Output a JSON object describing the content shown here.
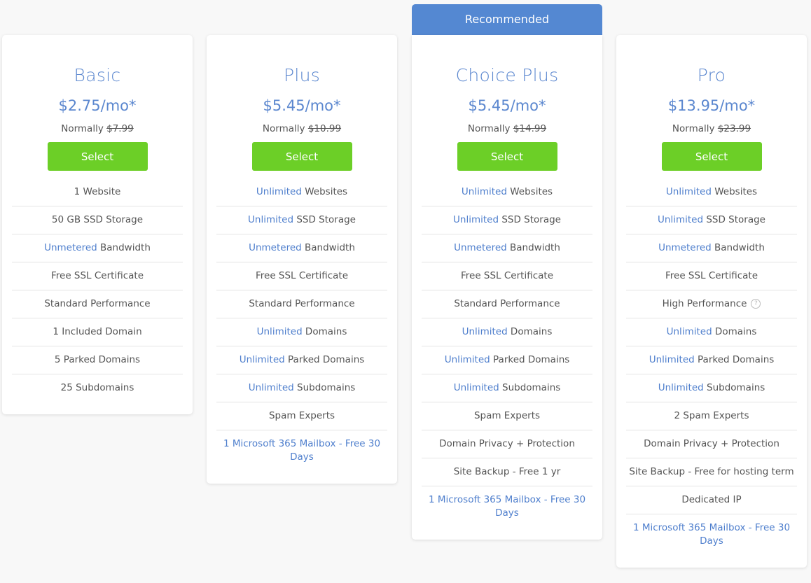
{
  "ribbon": {
    "label": "Recommended",
    "color": "#5488d2"
  },
  "colors": {
    "accent": "#5b87cf",
    "button": "#6ccf27"
  },
  "plans": [
    {
      "name": "Basic",
      "price": "$2.75/mo*",
      "normally_label": "Normally",
      "normal_price": "$7.99",
      "select_label": "Select",
      "features": [
        {
          "hl": "",
          "text": "1 Website"
        },
        {
          "hl": "",
          "text": "50 GB SSD Storage"
        },
        {
          "hl": "Unmetered",
          "text": " Bandwidth"
        },
        {
          "hl": "",
          "text": "Free SSL Certificate"
        },
        {
          "hl": "",
          "text": "Standard Performance"
        },
        {
          "hl": "",
          "text": "1 Included Domain"
        },
        {
          "hl": "",
          "text": "5 Parked Domains"
        },
        {
          "hl": "",
          "text": "25 Subdomains"
        }
      ]
    },
    {
      "name": "Plus",
      "price": "$5.45/mo*",
      "normally_label": "Normally",
      "normal_price": "$10.99",
      "select_label": "Select",
      "features": [
        {
          "hl": "Unlimited",
          "text": " Websites"
        },
        {
          "hl": "Unlimited",
          "text": " SSD Storage"
        },
        {
          "hl": "Unmetered",
          "text": " Bandwidth"
        },
        {
          "hl": "",
          "text": "Free SSL Certificate"
        },
        {
          "hl": "",
          "text": "Standard Performance"
        },
        {
          "hl": "Unlimited",
          "text": " Domains"
        },
        {
          "hl": "Unlimited",
          "text": " Parked Domains"
        },
        {
          "hl": "Unlimited",
          "text": " Subdomains"
        },
        {
          "hl": "",
          "text": "Spam Experts"
        },
        {
          "link": "1 Microsoft 365 Mailbox - Free 30 Days"
        }
      ]
    },
    {
      "name": "Choice Plus",
      "price": "$5.45/mo*",
      "normally_label": "Normally",
      "normal_price": "$14.99",
      "select_label": "Select",
      "recommended": true,
      "features": [
        {
          "hl": "Unlimited",
          "text": " Websites"
        },
        {
          "hl": "Unlimited",
          "text": " SSD Storage"
        },
        {
          "hl": "Unmetered",
          "text": " Bandwidth"
        },
        {
          "hl": "",
          "text": "Free SSL Certificate"
        },
        {
          "hl": "",
          "text": "Standard Performance"
        },
        {
          "hl": "Unlimited",
          "text": " Domains"
        },
        {
          "hl": "Unlimited",
          "text": " Parked Domains"
        },
        {
          "hl": "Unlimited",
          "text": " Subdomains"
        },
        {
          "hl": "",
          "text": "Spam Experts"
        },
        {
          "hl": "",
          "text": "Domain Privacy + Protection"
        },
        {
          "hl": "",
          "text": "Site Backup - Free 1 yr"
        },
        {
          "link": "1 Microsoft 365 Mailbox - Free 30 Days"
        }
      ]
    },
    {
      "name": "Pro",
      "price": "$13.95/mo*",
      "normally_label": "Normally",
      "normal_price": "$23.99",
      "select_label": "Select",
      "features": [
        {
          "hl": "Unlimited",
          "text": " Websites"
        },
        {
          "hl": "Unlimited",
          "text": " SSD Storage"
        },
        {
          "hl": "Unmetered",
          "text": " Bandwidth"
        },
        {
          "hl": "",
          "text": "Free SSL Certificate"
        },
        {
          "hl": "",
          "text": "High Performance",
          "help_icon": "question-circle-icon",
          "help_glyph": "?"
        },
        {
          "hl": "Unlimited",
          "text": " Domains"
        },
        {
          "hl": "Unlimited",
          "text": " Parked Domains"
        },
        {
          "hl": "Unlimited",
          "text": " Subdomains"
        },
        {
          "hl": "",
          "text": "2 Spam Experts"
        },
        {
          "hl": "",
          "text": "Domain Privacy + Protection"
        },
        {
          "hl": "",
          "text": "Site Backup - Free for hosting term"
        },
        {
          "hl": "",
          "text": "Dedicated IP"
        },
        {
          "link": "1 Microsoft 365 Mailbox - Free 30 Days"
        }
      ]
    }
  ]
}
